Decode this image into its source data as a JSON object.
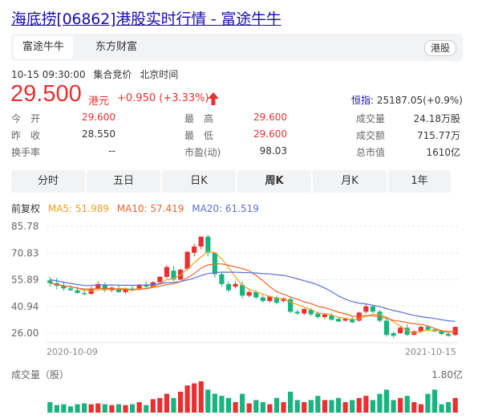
{
  "header": {
    "title": "海底捞[06862]港股实时行情 - 富途牛牛"
  },
  "tabs": [
    {
      "label": "富途牛牛"
    },
    {
      "label": "东方财富"
    }
  ],
  "market_badge": "港股",
  "quote": {
    "timestamp": "10-15 09:30:00",
    "status": "集合竞价",
    "tz": "北京时间",
    "price": "29.500",
    "unit": "港元",
    "change": "+0.950 (+3.33%)",
    "index_label": "恒指:",
    "index_value": "25187.05(+0.9%)"
  },
  "stats": {
    "open_label": "今　开",
    "open": "29.600",
    "prev_label": "昨　收",
    "prev": "28.550",
    "turnover_label": "换手率",
    "turnover": "--",
    "high_label": "最　高",
    "high": "29.600",
    "low_label": "最　低",
    "low": "29.600",
    "pe_label": "市盈(动)",
    "pe": "98.03",
    "vol_label": "成交量",
    "vol": "24.18万股",
    "amt_label": "成交额",
    "amt": "715.77万",
    "cap_label": "总市值",
    "cap": "1610亿"
  },
  "periods": [
    {
      "label": "分时"
    },
    {
      "label": "五日"
    },
    {
      "label": "日K"
    },
    {
      "label": "周K"
    },
    {
      "label": "月K"
    },
    {
      "label": "1年"
    }
  ],
  "legend": {
    "adj": "前复权",
    "ma5": "MA5: 51.989",
    "ma10": "MA10: 57.419",
    "ma20": "MA20: 61.519"
  },
  "colors": {
    "up": "#e93030",
    "down": "#19b37f",
    "ma5": "#f0a020",
    "ma10": "#ec6428",
    "ma20": "#5b6fd8"
  },
  "chart_data": {
    "type": "candlestick",
    "y_ticks": [
      "85.78",
      "70.83",
      "55.89",
      "40.94",
      "26.00"
    ],
    "y_values": [
      85.78,
      70.83,
      55.89,
      40.94,
      26.0
    ],
    "x_start": "2020-10-09",
    "x_end": "2021-10-15",
    "candles": [
      [
        55.5,
        57.5,
        54,
        52
      ],
      [
        54,
        57,
        52.5,
        50.5
      ],
      [
        52.5,
        55,
        51,
        49.8
      ],
      [
        51,
        53,
        50,
        49.5
      ],
      [
        50,
        52,
        48.5,
        48
      ],
      [
        48.5,
        51,
        48,
        47
      ],
      [
        48,
        52,
        50.8,
        47.5
      ],
      [
        51,
        55,
        53.5,
        50
      ],
      [
        53,
        54.5,
        50,
        49
      ],
      [
        50,
        52,
        51.5,
        49
      ],
      [
        51,
        53,
        49,
        48.5
      ],
      [
        49,
        51.5,
        51,
        48
      ],
      [
        51,
        52.5,
        50,
        49.3
      ],
      [
        50.5,
        53.5,
        53,
        50
      ],
      [
        53,
        55,
        52,
        51
      ],
      [
        52,
        55,
        54.5,
        51.5
      ],
      [
        54.5,
        58,
        57.5,
        53.5
      ],
      [
        57.5,
        64,
        63,
        56.5
      ],
      [
        61,
        63.5,
        56,
        55
      ],
      [
        56,
        62,
        61.5,
        55.5
      ],
      [
        62,
        72,
        71.5,
        61
      ],
      [
        71,
        76,
        74.5,
        69
      ],
      [
        74.5,
        78.5,
        80,
        73
      ],
      [
        80,
        81,
        71,
        69
      ],
      [
        71,
        71.5,
        59,
        57
      ],
      [
        59,
        60,
        53.5,
        52
      ],
      [
        53.5,
        55,
        50,
        49
      ],
      [
        52,
        55,
        53.5,
        51
      ],
      [
        53,
        55,
        47,
        45.5
      ],
      [
        47,
        50,
        49,
        46
      ],
      [
        49,
        50,
        46,
        45
      ],
      [
        46,
        47.5,
        44,
        43
      ],
      [
        44,
        47,
        46.5,
        43
      ],
      [
        46,
        47,
        43,
        42
      ],
      [
        44,
        46,
        45.5,
        43
      ],
      [
        45,
        46.5,
        38,
        37
      ],
      [
        38,
        39,
        37,
        36
      ],
      [
        37,
        40,
        39.5,
        36
      ],
      [
        39,
        40,
        36.5,
        35.5
      ],
      [
        37,
        38,
        35,
        34
      ],
      [
        35,
        37,
        36.5,
        34
      ],
      [
        36,
        37,
        33.5,
        33
      ],
      [
        34,
        35,
        32.5,
        32
      ],
      [
        33,
        34.5,
        34,
        32.5
      ],
      [
        34,
        35.5,
        32,
        31.5
      ],
      [
        33,
        38,
        37.5,
        32.5
      ],
      [
        38,
        42,
        41,
        37
      ],
      [
        41,
        41.5,
        38,
        37
      ],
      [
        38,
        39,
        33,
        32
      ],
      [
        33,
        34,
        25,
        24
      ],
      [
        26,
        27,
        24.5,
        23.5
      ],
      [
        26,
        30,
        29,
        25.5
      ],
      [
        29,
        31,
        25,
        24.5
      ],
      [
        25,
        27.5,
        27,
        24.8
      ],
      [
        27,
        30,
        29.5,
        26
      ],
      [
        29.5,
        30.5,
        28,
        27
      ],
      [
        28,
        28.5,
        27,
        26.5
      ],
      [
        27,
        27.5,
        25.5,
        25
      ],
      [
        25.5,
        26.5,
        24.5,
        24
      ],
      [
        25,
        29.6,
        29.5,
        24.5
      ]
    ],
    "ma5_path": [
      [
        0,
        55.2
      ],
      [
        10,
        52.8
      ],
      [
        20,
        52.2
      ],
      [
        30,
        53
      ],
      [
        40,
        54
      ],
      [
        50,
        56
      ],
      [
        60,
        58.5
      ],
      [
        70,
        61
      ],
      [
        80,
        64
      ],
      [
        90,
        66
      ],
      [
        100,
        67
      ],
      [
        110,
        66
      ],
      [
        120,
        63
      ],
      [
        130,
        60
      ],
      [
        140,
        57
      ],
      [
        150,
        55
      ],
      [
        160,
        53
      ],
      [
        170,
        51
      ],
      [
        180,
        49
      ],
      [
        190,
        47
      ],
      [
        200,
        45
      ],
      [
        210,
        43
      ],
      [
        220,
        41
      ],
      [
        230,
        40
      ],
      [
        240,
        39
      ],
      [
        250,
        38
      ],
      [
        260,
        37
      ],
      [
        270,
        36
      ],
      [
        280,
        35
      ],
      [
        290,
        34.5
      ]
    ],
    "ma20_path": [
      [
        0,
        45
      ],
      [
        60,
        50
      ],
      [
        120,
        55
      ],
      [
        180,
        57
      ],
      [
        240,
        57.5
      ],
      [
        300,
        56
      ],
      [
        360,
        53
      ],
      [
        420,
        49
      ],
      [
        480,
        45
      ],
      [
        540,
        41
      ],
      [
        600,
        37
      ],
      [
        660,
        33
      ],
      [
        720,
        30
      ],
      [
        780,
        28.5
      ],
      [
        840,
        28
      ]
    ],
    "vol_title": "成交量（股）",
    "vol_max": "1.80亿",
    "volumes": [
      0.25,
      0.18,
      0.2,
      0.15,
      0.2,
      0.22,
      0.2,
      0.22,
      0.2,
      0.18,
      0.2,
      0.18,
      0.2,
      0.25,
      0.18,
      0.32,
      0.35,
      0.45,
      0.35,
      0.5,
      0.65,
      0.7,
      0.75,
      0.55,
      0.45,
      0.4,
      0.35,
      0.25,
      0.45,
      0.22,
      0.3,
      0.25,
      0.2,
      0.35,
      0.25,
      0.5,
      0.3,
      0.25,
      0.3,
      0.4,
      0.3,
      0.3,
      0.35,
      0.25,
      0.3,
      0.35,
      0.4,
      0.3,
      0.45,
      0.55,
      0.3,
      0.35,
      0.4,
      0.25,
      0.2,
      0.45,
      0.55,
      0.2,
      0.25,
      0.35
    ]
  }
}
